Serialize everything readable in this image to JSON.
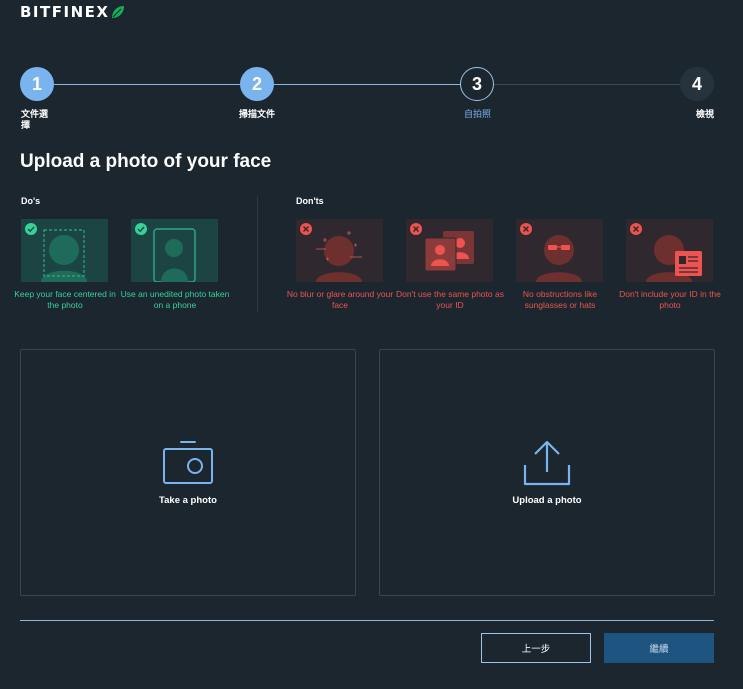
{
  "brand": {
    "name": "BITFINEX"
  },
  "colors": {
    "background": "#1b262f",
    "step_active": "#7ab4ee",
    "step_current_border": "#9fc2e8",
    "step_inactive": "#26323c",
    "do_green": "#34d399",
    "dont_red": "#ef5350",
    "primary_button": "#1e5580"
  },
  "stepper": {
    "steps": [
      {
        "number": "1",
        "label": "文件選擇",
        "state": "complete"
      },
      {
        "number": "2",
        "label": "掃描文件",
        "state": "complete"
      },
      {
        "number": "3",
        "label": "自拍照",
        "state": "current"
      },
      {
        "number": "4",
        "label": "檢視",
        "state": "upcoming"
      }
    ]
  },
  "page": {
    "title": "Upload a photo of your face"
  },
  "guidelines": {
    "dos_label": "Do's",
    "donts_label": "Don'ts",
    "dos": [
      {
        "icon": "face-centered-icon",
        "caption": "Keep your face centered in the photo"
      },
      {
        "icon": "phone-photo-icon",
        "caption": "Use an unedited photo taken on a phone"
      }
    ],
    "donts": [
      {
        "icon": "blur-glare-icon",
        "caption": "No blur or glare around your face"
      },
      {
        "icon": "id-photo-icon",
        "caption": "Don't use the same photo as your ID"
      },
      {
        "icon": "sunglasses-icon",
        "caption": "No obstructions like sunglasses or hats"
      },
      {
        "icon": "id-card-icon",
        "caption": "Don't include your ID in the photo"
      }
    ]
  },
  "upload": {
    "take_photo": {
      "label": "Take a photo",
      "icon": "camera-icon"
    },
    "upload_photo": {
      "label": "Upload a photo",
      "icon": "upload-icon"
    }
  },
  "actions": {
    "back_label": "上一步",
    "continue_label": "繼續"
  }
}
